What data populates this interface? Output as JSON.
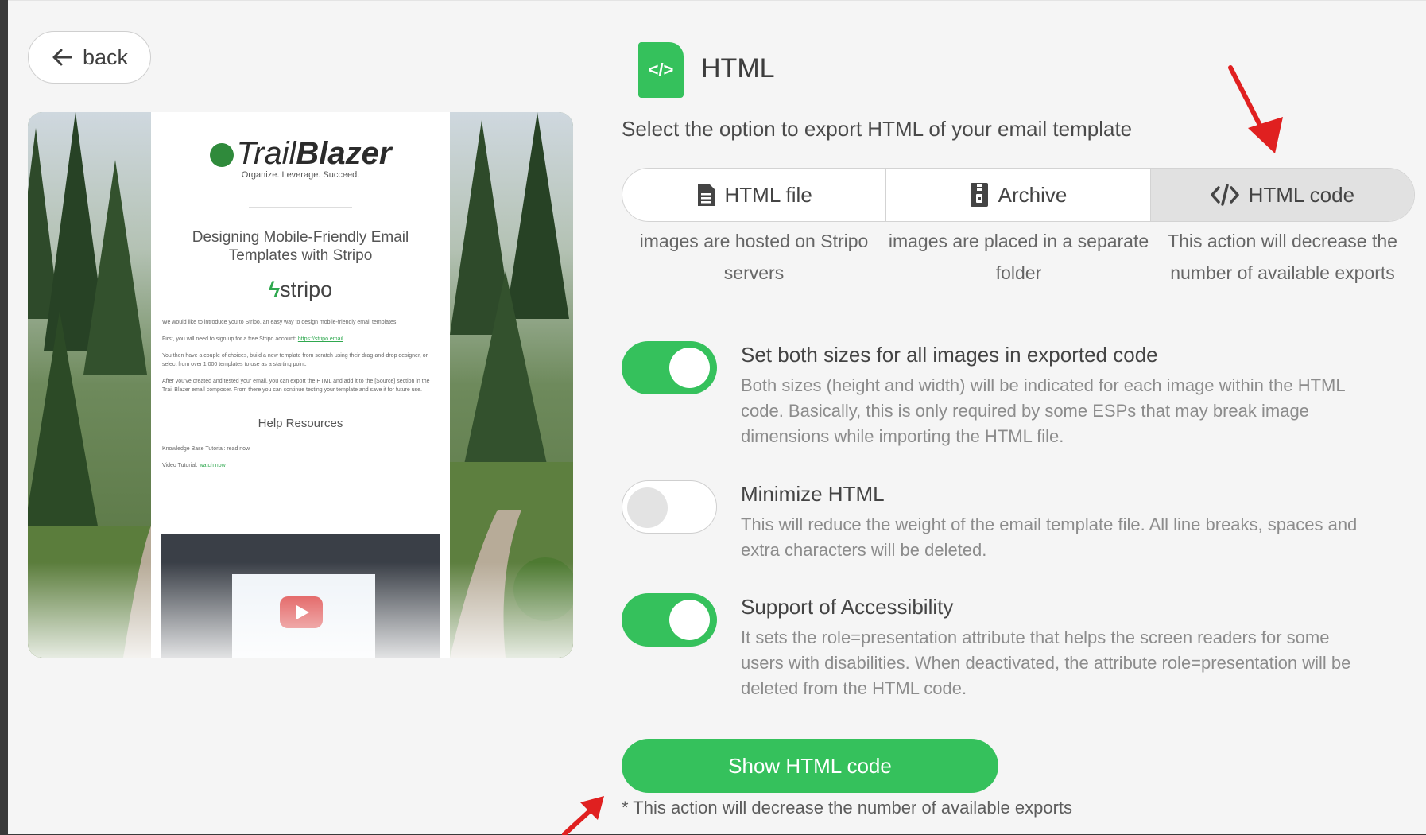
{
  "back_label": "back",
  "preview": {
    "logo_part1": "Trail",
    "logo_part2": "Blazer",
    "tagline": "Organize. Leverage. Succeed.",
    "heading": "Designing Mobile-Friendly Email Templates with Stripo",
    "stripo_logo": "stripo",
    "paragraphs": [
      "We would like to introduce you to Stripo, an easy way to design mobile-friendly email templates.",
      "First, you will need to sign up for a free Stripo account:",
      "You then have a couple of choices, build a new template from scratch using their drag-and-drop designer, or select from over 1,000 templates to use as a starting point.",
      "After you've created and tested your email, you can export the HTML and add it to the [Source] section in the Trail Blazer email composer. From there you can continue testing your template and save it for future use."
    ],
    "signup_link": "https://stripo.email",
    "help_title": "Help Resources",
    "kb_line": "Knowledge Base Tutorial: read now",
    "video_line": "Video Tutorial:",
    "video_link": "watch now"
  },
  "header": {
    "icon_text": "</>",
    "title": "HTML",
    "subtitle": "Select the option to export HTML of your email template"
  },
  "export_options": [
    {
      "label": "HTML file",
      "icon": "document-icon",
      "desc": "images are hosted on Stripo servers",
      "active": false
    },
    {
      "label": "Archive",
      "icon": "archive-icon",
      "desc": "images are placed in a separate folder",
      "active": false
    },
    {
      "label": "HTML code",
      "icon": "code-icon",
      "desc": "This action will decrease the number of available exports",
      "active": true
    }
  ],
  "settings": [
    {
      "title": "Set both sizes for all images in exported code",
      "desc": "Both sizes (height and width) will be indicated for each image within the HTML code. Basically, this is only required by some ESPs that may break image dimensions while importing the HTML file.",
      "enabled": true
    },
    {
      "title": "Minimize HTML",
      "desc": "This will reduce the weight of the email template file. All line breaks, spaces and extra characters will be deleted.",
      "enabled": false
    },
    {
      "title": "Support of Accessibility",
      "desc": "It sets the role=presentation attribute that helps the screen readers for some users with disabilities. When deactivated, the attribute role=presentation will be deleted from the HTML code.",
      "enabled": true
    }
  ],
  "show_button_label": "Show HTML code",
  "footnote": "* This action will decrease the number of available exports",
  "colors": {
    "accent": "#35c15c",
    "annotation_arrow": "#e02020"
  }
}
